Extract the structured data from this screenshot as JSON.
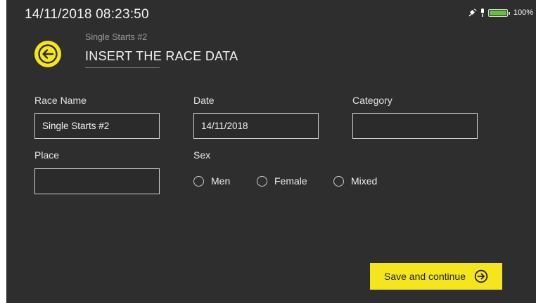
{
  "status_bar": {
    "clock": "14/11/2018  08:23:50",
    "battery_percent": "100%",
    "battery_level": 1.0,
    "icons": [
      "satellite-icon",
      "microphone-icon",
      "battery-icon"
    ]
  },
  "header": {
    "back_icon": "back-arrow-icon",
    "subtitle": "Single Starts #2",
    "title": "INSERT THE RACE DATA"
  },
  "form": {
    "race_name": {
      "label": "Race Name",
      "value": "Single Starts #2"
    },
    "date": {
      "label": "Date",
      "value": "14/11/2018"
    },
    "category": {
      "label": "Category",
      "value": ""
    },
    "place": {
      "label": "Place",
      "value": ""
    },
    "sex": {
      "label": "Sex",
      "options": [
        "Men",
        "Female",
        "Mixed"
      ],
      "selected": ""
    }
  },
  "actions": {
    "save_label": "Save and continue",
    "save_icon": "arrow-right-circle-icon"
  },
  "colors": {
    "background": "#2e2e2e",
    "accent": "#f5e51d",
    "text": "#e6e6e6"
  }
}
